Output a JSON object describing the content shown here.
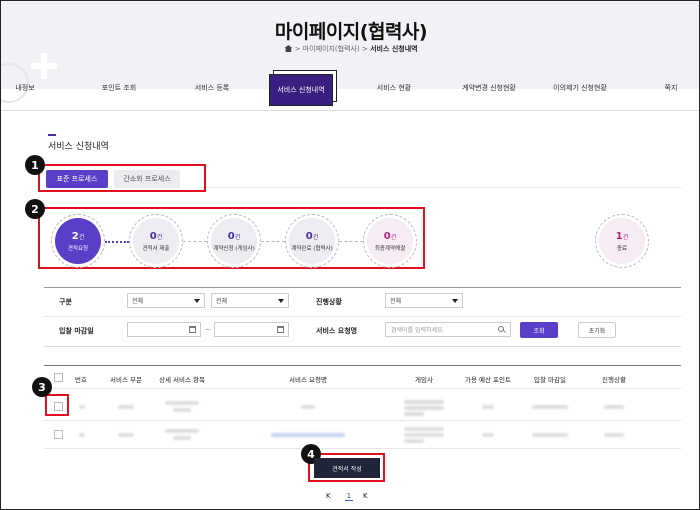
{
  "header": {
    "title": "마이페이지(협력사)",
    "breadcrumb": {
      "sep": ">",
      "parent": "마이페이지(협력사)",
      "current": "서비스 신청내역"
    }
  },
  "nav": {
    "items": [
      {
        "label": "내정보"
      },
      {
        "label": "포인트 조회"
      },
      {
        "label": "서비스 등록"
      },
      {
        "label": "서비스 신청내역",
        "active": true
      },
      {
        "label": "서비스 현황"
      },
      {
        "label": "계약변경 신청현황"
      },
      {
        "label": "이의제기 신청현황"
      },
      {
        "label": "쪽지"
      }
    ]
  },
  "section": {
    "title": "서비스 신청내역"
  },
  "process_tabs": {
    "standard": "표준 프로세스",
    "simple": "간소화 프로세스"
  },
  "steps": [
    {
      "count": "2",
      "unit": "건",
      "label": "견적요청"
    },
    {
      "count": "0",
      "unit": "건",
      "label": "견적서 제출"
    },
    {
      "count": "0",
      "unit": "건",
      "label": "계약신청 (게임사)"
    },
    {
      "count": "0",
      "unit": "건",
      "label": "계약완료 (협력사)"
    },
    {
      "count": "0",
      "unit": "건",
      "label": "최종계약해결"
    },
    {
      "count": "1",
      "unit": "건",
      "label": "종료"
    }
  ],
  "filters": {
    "category_label": "구분",
    "category_select_1": "전체",
    "category_select_2": "전체",
    "status_label": "진행상황",
    "status_select": "전체",
    "deadline_label": "입찰 마감일",
    "date_sep": "~",
    "request_name_label": "서비스 요청명",
    "search_placeholder": "검색어를 입력하세요.",
    "search_button": "조회",
    "reset_button": "초기화"
  },
  "table": {
    "headers": [
      "번호",
      "서비스 부문",
      "상세 서비스 항목",
      "서비스 요청명",
      "게임사",
      "가용 예산 포인트",
      "입찰 마감일",
      "진행상황"
    ]
  },
  "write_button": "견적서 작성",
  "pager": {
    "first": "K",
    "page": "1",
    "last": "K"
  },
  "annotations": [
    "1",
    "2",
    "3",
    "4"
  ],
  "colors": {
    "accent": "#5b3ec8",
    "nav_active": "#3b1f80",
    "highlight": "#e01020",
    "dark_button": "#1f2438"
  }
}
